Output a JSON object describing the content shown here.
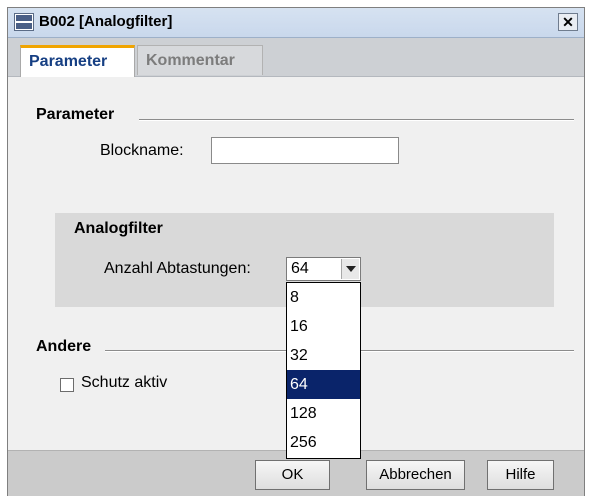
{
  "window": {
    "title": "B002 [Analogfilter]",
    "app_icon": "logo-icon",
    "close_glyph": "✕"
  },
  "tabs": [
    {
      "label": "Parameter",
      "active": true
    },
    {
      "label": "Kommentar",
      "active": false
    }
  ],
  "parameter_section": {
    "title": "Parameter",
    "blockname_label": "Blockname:",
    "blockname_value": ""
  },
  "analogfilter_group": {
    "title": "Analogfilter",
    "samples_label": "Anzahl Abtastungen:",
    "samples_value": "64",
    "options": [
      "8",
      "16",
      "32",
      "64",
      "128",
      "256"
    ]
  },
  "other_section": {
    "title": "Andere",
    "protection_label": "Schutz aktiv",
    "protection_checked": false
  },
  "buttons": {
    "ok": "OK",
    "cancel": "Abbrechen",
    "help": "Hilfe"
  },
  "colors": {
    "tab_accent": "#f0a400",
    "active_tab_text": "#163f83",
    "selection": "#0a246a"
  }
}
